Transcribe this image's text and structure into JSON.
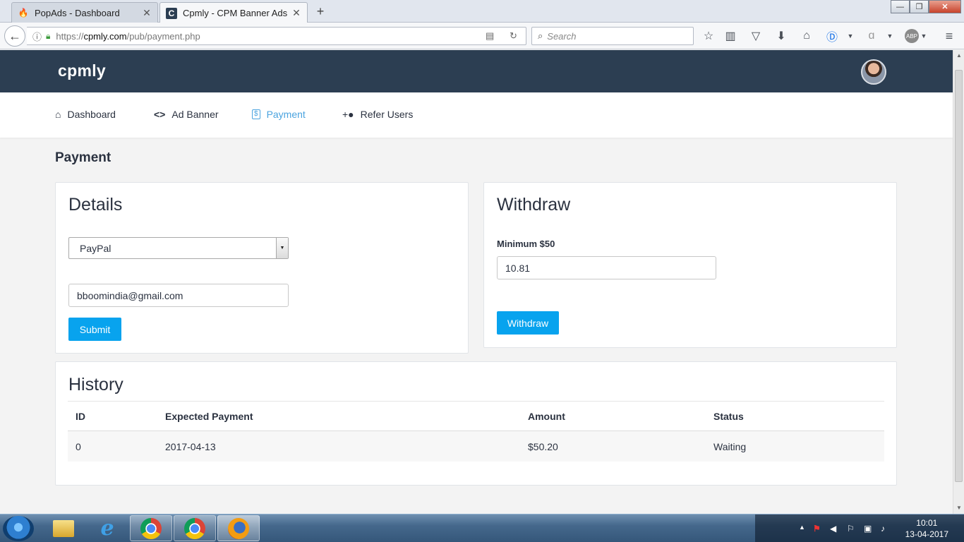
{
  "browser": {
    "tabs": [
      {
        "title": "PopAds - Dashboard",
        "favicon": "popads-icon"
      },
      {
        "title": "Cpmly - CPM Banner Ads",
        "favicon": "cpmly-icon"
      }
    ],
    "url": {
      "prefix": "https://",
      "domain": "cpmly.com",
      "path": "/pub/payment.php"
    },
    "search_placeholder": "Search"
  },
  "site": {
    "logo": "cpmly",
    "nav": [
      {
        "label": "Dashboard",
        "icon": "home-icon",
        "active": false
      },
      {
        "label": "Ad Banner",
        "icon": "code-icon",
        "active": false
      },
      {
        "label": "Payment",
        "icon": "dollar-icon",
        "active": true
      },
      {
        "label": "Refer Users",
        "icon": "add-user-icon",
        "active": false
      }
    ],
    "accent_color": "#08a3ee",
    "header_color": "#2c3e52"
  },
  "page_title": "Payment",
  "details": {
    "title": "Details",
    "method_selected": "PayPal",
    "email_value": "bboomindia@gmail.com",
    "submit_label": "Submit"
  },
  "withdraw": {
    "title": "Withdraw",
    "minimum_label": "Minimum $50",
    "amount_value": "10.81",
    "button_label": "Withdraw"
  },
  "history": {
    "title": "History",
    "columns": [
      "ID",
      "Expected Payment",
      "Amount",
      "Status"
    ],
    "rows": [
      [
        "0",
        "2017-04-13",
        "$50.20",
        "Waiting"
      ]
    ]
  },
  "taskbar": {
    "time": "10:01",
    "date": "13-04-2017"
  }
}
